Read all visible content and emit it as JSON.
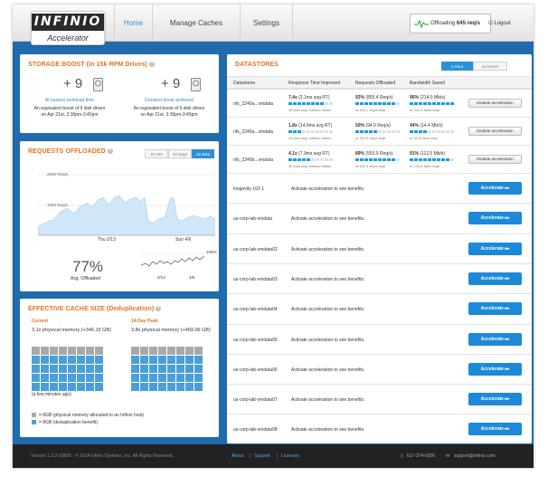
{
  "header": {
    "logo_name": "INFINIO",
    "logo_sub": "Accelerator",
    "nav": [
      "Home",
      "Manage Caches",
      "Settings"
    ],
    "offloading_label": "Offloading",
    "offloading_value": "645 req/s",
    "logout": "Logout"
  },
  "storage_boost": {
    "title": "STORAGE BOOST (In 15k RPM Drives)",
    "left": {
      "value": "+ 9",
      "caption": "At busiest workload time",
      "line1": "An equivalent boost of 9 disk drives",
      "line2": "on Apr 21st, 3:30pm-3:45pm"
    },
    "right": {
      "value": "+ 9",
      "caption": "Greatest boost achieved",
      "line1": "An equivalent boost of 9 disk drives",
      "line2": "on Apr 21st, 3:30pm-3:45pm"
    }
  },
  "requests": {
    "title": "REQUESTS OFFLOADED",
    "ranges": [
      "24 Hrs",
      "14 Days",
      "16 Wks"
    ],
    "active_range": "16 Wks",
    "y_labels": [
      "2000 Req/s",
      "1000 Req/s"
    ],
    "x_labels": [
      "Thu 2/13",
      "Sun 4/6"
    ],
    "pct": "77%",
    "pct_label": "Avg. Offloaded",
    "mini_top": "100%",
    "mini_x": [
      "2/13",
      "4/6"
    ]
  },
  "cache": {
    "title": "EFFECTIVE CACHE SIZE (Deduplication)",
    "current_label": "Current",
    "current_value": "3.1x physical memory (+346.15 GB)",
    "peak_label": "14-Day Peak",
    "peak_value": "3.8x physical memory (+459.06 GB)",
    "note": "(a few minutes ago)",
    "legend1": "= 8GB (physical memory allocated to an Infinio host)",
    "legend2": "= 8GB (deduplication benefit)"
  },
  "datastores": {
    "title": "DATASTORES",
    "ranges": [
      "1 Hour",
      "24 Hours"
    ],
    "active_range": "1 Hour",
    "columns": [
      "Datastores",
      "Response Time Improved",
      "Requests Offloaded",
      "Bandwidth Saved"
    ],
    "active": [
      {
        "name": "nfs_2240a...vmdata",
        "rt": "7.4x",
        "rt_detail": "(2.1ms avg RT)",
        "rt_sub": "15.6ms avg. without Infinio",
        "rq": "93%",
        "rq_detail": "(855.4 Req/s)",
        "rq_sub": "of 923.1 req/s total",
        "bw": "96%",
        "bw_detail": "(214.0 Mb/s)",
        "bw_sub": "of 224.3 Mb/s total",
        "button": "Disable acceleration"
      },
      {
        "name": "nfs_2240a...vmdata",
        "rt": "1.8x",
        "rt_detail": "(14.0ms avg RT)",
        "rt_sub": "25.8ms avg. without Infinio",
        "rq": "50%",
        "rq_detail": "(94.0 Req/s)",
        "rq_sub": "of 187.5 req/s total",
        "bw": "44%",
        "bw_detail": "(14.4 Mb/s)",
        "bw_sub": "of 32.8 Mb/s total",
        "button": "Disable acceleration"
      },
      {
        "name": "nfs_2240b...vmdata",
        "rt": "4.1x",
        "rt_detail": "(7.9ms avg RT)",
        "rt_sub": "32.6ms avg. without Infinio",
        "rq": "89%",
        "rq_detail": "(553.0 Req/s)",
        "rq_sub": "of 621.4 req/s total",
        "bw": "91%",
        "bw_detail": "(112.5 Mb/s)",
        "bw_sub": "of 123.6 Mb/s total",
        "button": "Disable acceleration"
      }
    ],
    "inactive": [
      {
        "name": "longevity-102-1"
      },
      {
        "name": "us-corp-lab-vmdata"
      },
      {
        "name": "us-corp-lab-vmdata02"
      },
      {
        "name": "us-corp-lab-vmdata03"
      },
      {
        "name": "us-corp-lab-vmdata04"
      },
      {
        "name": "us-corp-lab-vmdata05"
      },
      {
        "name": "us-corp-lab-vmdata06"
      },
      {
        "name": "us-corp-lab-vmdata07"
      },
      {
        "name": "us-corp-lab-vmdata08"
      }
    ],
    "inactive_msg": "Activate acceleration to see benefits.",
    "accel_button": "Accelerate"
  },
  "footer": {
    "version": "Version 1.3.2-10806 - © 2014 Infinio Systems, Inc. All Rights Reserved.",
    "links": [
      "About",
      "Support",
      "Licenses"
    ],
    "phone": "617-374-6500",
    "email": "support@infinio.com"
  }
}
